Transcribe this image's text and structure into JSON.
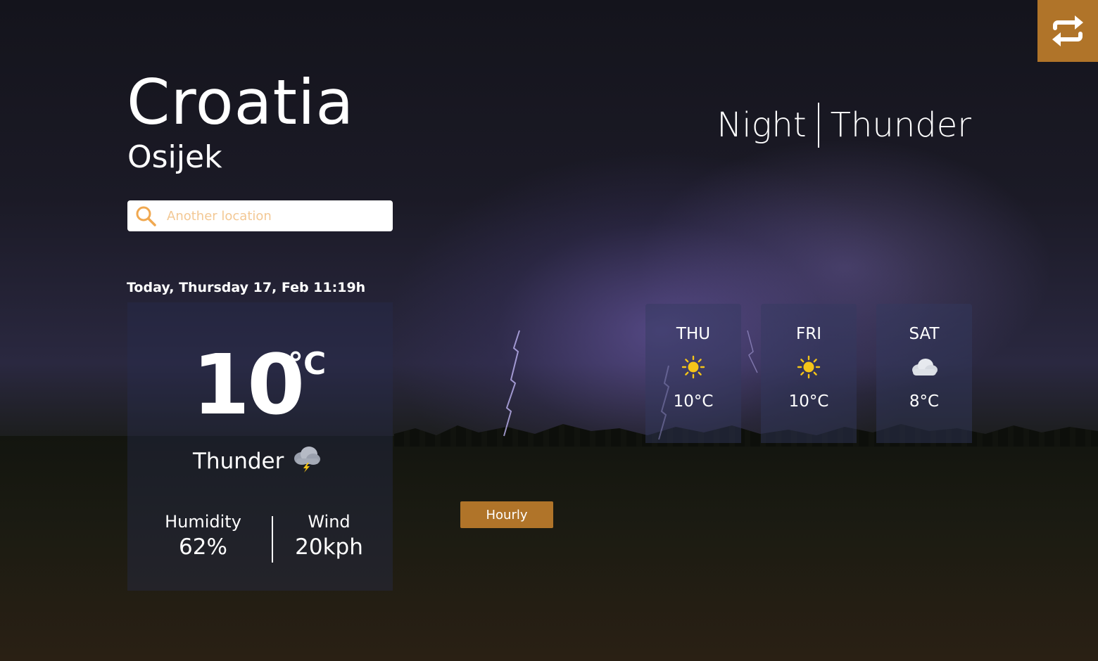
{
  "location": {
    "country": "Croatia",
    "city": "Osijek"
  },
  "search": {
    "placeholder": "Another location",
    "value": ""
  },
  "datetime": "Today, Thursday 17, Feb 11:19h",
  "current": {
    "temperature": "10",
    "unit": "°C",
    "condition": "Thunder",
    "condition_icon": "thunder-cloud-icon",
    "humidity_label": "Humidity",
    "humidity_value": "62%",
    "wind_label": "Wind",
    "wind_value": "20kph"
  },
  "heading": {
    "time_of_day": "Night",
    "condition": "Thunder"
  },
  "forecast": [
    {
      "day": "THU",
      "icon": "sun-icon",
      "temp": "10°C"
    },
    {
      "day": "FRI",
      "icon": "sun-icon",
      "temp": "10°C"
    },
    {
      "day": "SAT",
      "icon": "cloud-icon",
      "temp": "8°C"
    }
  ],
  "buttons": {
    "hourly": "Hourly",
    "swap_icon": "swap-arrows-icon"
  },
  "colors": {
    "accent": "#b07429",
    "sun": "#f5c518",
    "placeholder": "#f3c894"
  }
}
